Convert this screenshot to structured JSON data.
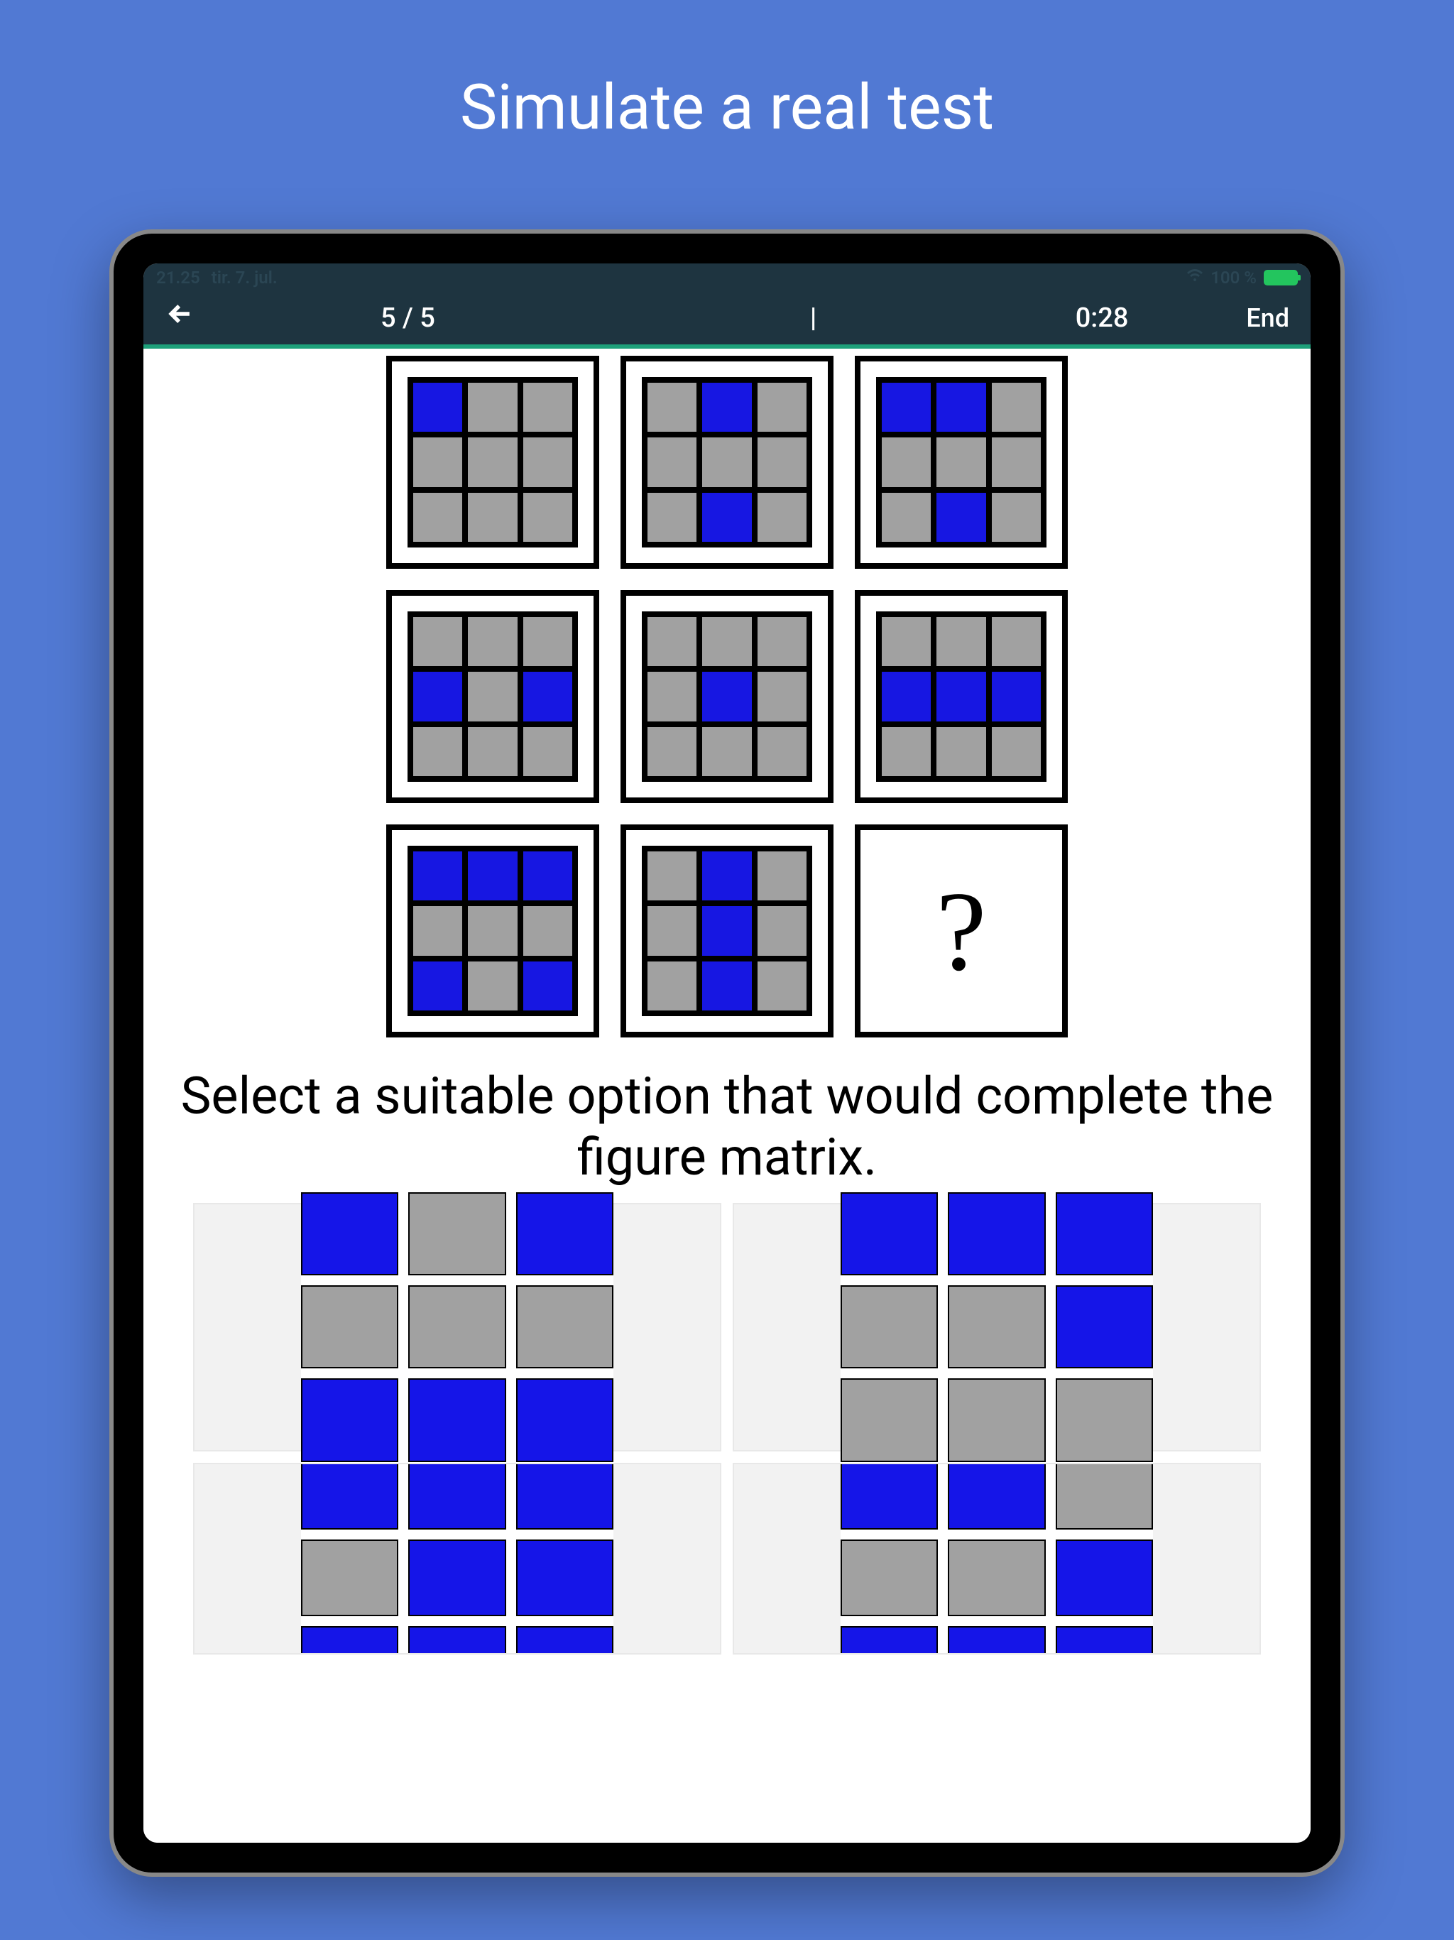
{
  "hero": {
    "title": "Simulate a real test"
  },
  "status": {
    "time": "21.25",
    "date": "tir. 7. jul.",
    "battery": "100 %"
  },
  "appbar": {
    "progress": "5 / 5",
    "sep": "|",
    "timer": "0:28",
    "end": "End"
  },
  "question_box": "?",
  "instruction": "Select a suitable option that would complete the figure matrix.",
  "matrix": [
    [
      [
        1,
        0,
        0,
        0,
        0,
        0,
        0,
        0,
        0
      ],
      [
        0,
        1,
        0,
        0,
        0,
        0,
        0,
        1,
        0
      ],
      [
        1,
        1,
        0,
        0,
        0,
        0,
        0,
        1,
        0
      ]
    ],
    [
      [
        0,
        0,
        0,
        1,
        0,
        1,
        0,
        0,
        0
      ],
      [
        0,
        0,
        0,
        0,
        1,
        0,
        0,
        0,
        0
      ],
      [
        0,
        0,
        0,
        1,
        1,
        1,
        0,
        0,
        0
      ]
    ],
    [
      [
        1,
        1,
        1,
        0,
        0,
        0,
        1,
        0,
        1
      ],
      [
        0,
        1,
        0,
        0,
        1,
        0,
        0,
        1,
        0
      ],
      null
    ]
  ],
  "answers": [
    [
      1,
      0,
      1,
      0,
      0,
      0,
      1,
      1,
      1
    ],
    [
      1,
      1,
      1,
      0,
      0,
      1,
      0,
      0,
      0
    ],
    [
      1,
      1,
      1,
      0,
      1,
      1,
      1,
      1,
      1
    ],
    [
      1,
      1,
      0,
      0,
      0,
      1,
      1,
      1,
      1
    ]
  ]
}
